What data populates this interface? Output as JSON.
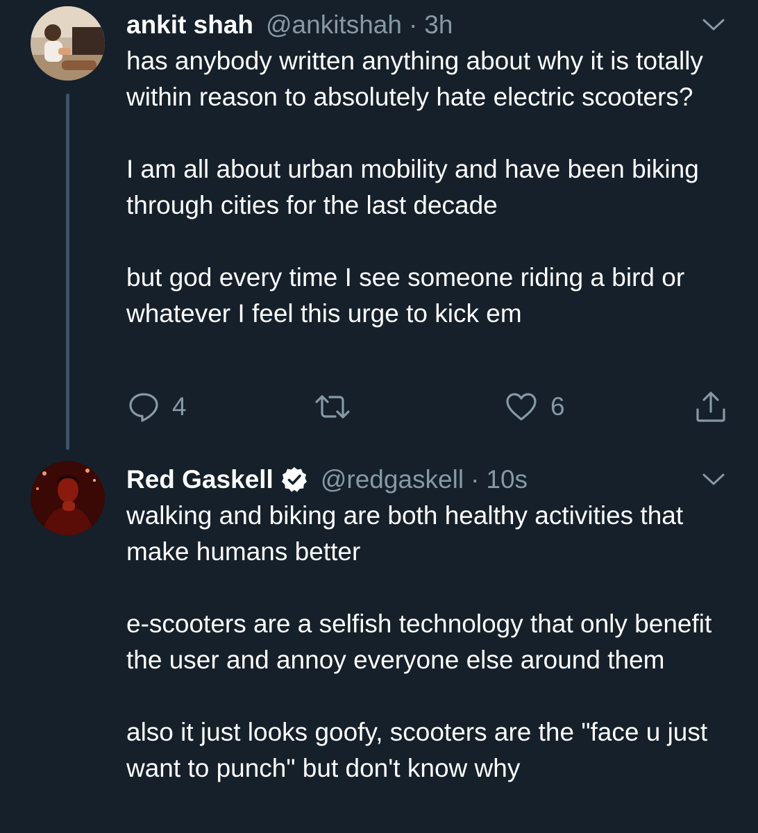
{
  "tweets": [
    {
      "name": "ankit shah",
      "handle": "@ankitshah",
      "separator": "·",
      "time": "3h",
      "paragraphs": [
        "has anybody written anything about why it is totally within reason to absolutely hate electric scooters?",
        "I am all about urban mobility and have been biking through cities for the last decade",
        "but god every time I see someone riding a bird or whatever I feel this urge to kick em"
      ],
      "reply_count": "4",
      "retweet_count": "",
      "like_count": "6"
    },
    {
      "name": "Red Gaskell",
      "handle": "@redgaskell",
      "separator": "·",
      "time": "10s",
      "verified": true,
      "paragraphs": [
        "walking and biking are both healthy activities that make humans better",
        "e-scooters are a selfish technology that only benefit the user and annoy everyone else around them",
        "also it just looks goofy, scooters are the \"face u just want to punch\" but don't know why"
      ]
    }
  ],
  "icons": {
    "caret": "chevron-down-icon",
    "reply": "reply-icon",
    "retweet": "retweet-icon",
    "like": "like-icon",
    "share": "share-icon",
    "verified": "verified-badge-icon"
  },
  "colors": {
    "background": "#15202b",
    "text": "#ffffff",
    "secondary": "#8899a6",
    "thread_line": "#3d5466"
  }
}
